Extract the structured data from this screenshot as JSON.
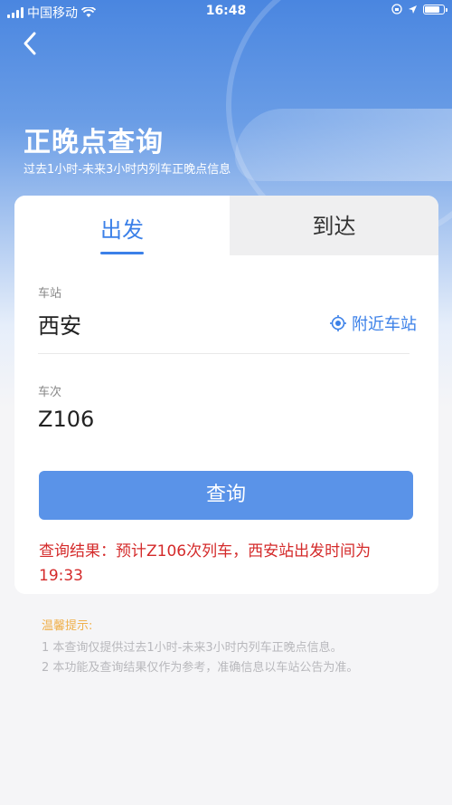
{
  "status_bar": {
    "carrier": "中国移动",
    "time": "16:48"
  },
  "header": {
    "title": "正晚点查询",
    "subtitle": "过去1小时-未来3小时内列车正晚点信息"
  },
  "tabs": [
    {
      "label": "出发",
      "active": true
    },
    {
      "label": "到达",
      "active": false
    }
  ],
  "form": {
    "station_label": "车站",
    "station_value": "西安",
    "nearby_label": "附近车站",
    "train_label": "车次",
    "train_value": "Z106",
    "query_button": "查询",
    "result_text": "查询结果：预计Z106次列车，西安站出发时间为 19:33"
  },
  "tips": {
    "title": "温馨提示:",
    "lines": [
      "1 本查询仅提供过去1小时-未来3小时内列车正晚点信息。",
      "2 本功能及查询结果仅作为参考，准确信息以车站公告为准。"
    ]
  },
  "colors": {
    "accent": "#3b80e8",
    "button": "#5a93e8",
    "result": "#d42a2a",
    "tips_title": "#f0b04b"
  }
}
